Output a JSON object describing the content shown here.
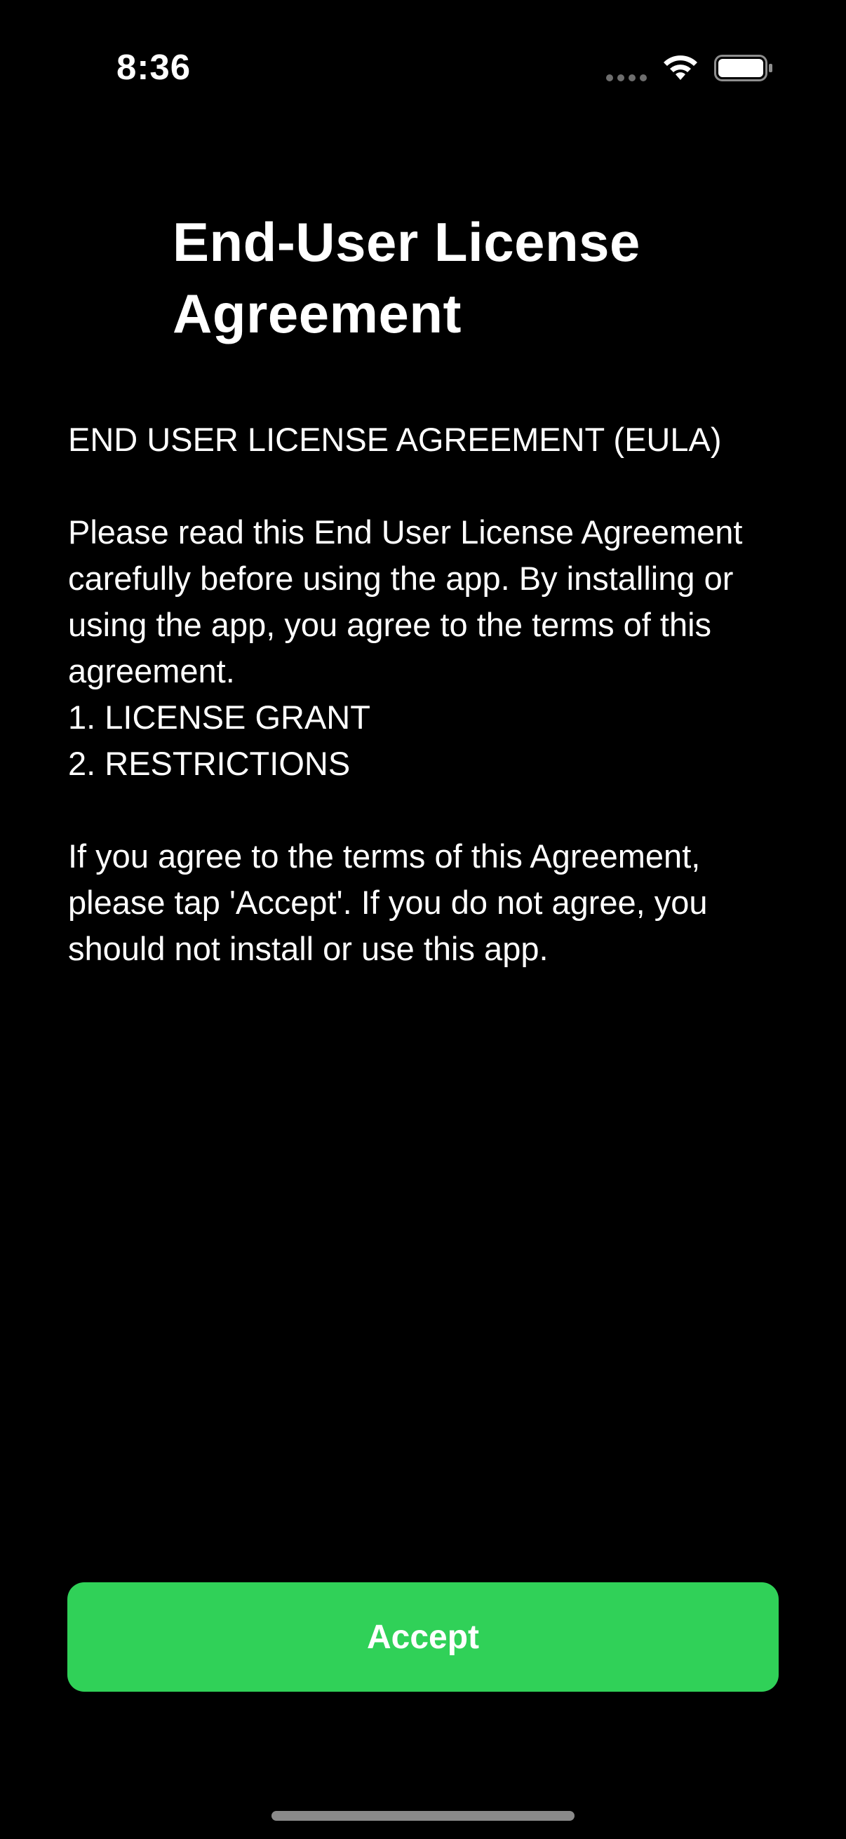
{
  "status_bar": {
    "time": "8:36",
    "signal_icon": "signal-dots-icon",
    "wifi_icon": "wifi-icon",
    "battery_icon": "battery-icon"
  },
  "page": {
    "title": "End-User License Agreement",
    "body": "END USER LICENSE AGREEMENT (EULA)\n\nPlease read this End User License Agreement carefully before using the app. By installing or using the app, you agree to the terms of this agreement.\n1. LICENSE GRANT\n2. RESTRICTIONS\n\nIf you agree to the terms of this Agreement, please tap 'Accept'. If you do not agree, you should not install or use this app."
  },
  "actions": {
    "accept_label": "Accept"
  },
  "colors": {
    "background": "#000000",
    "text": "#ffffff",
    "accent": "#30d158"
  }
}
